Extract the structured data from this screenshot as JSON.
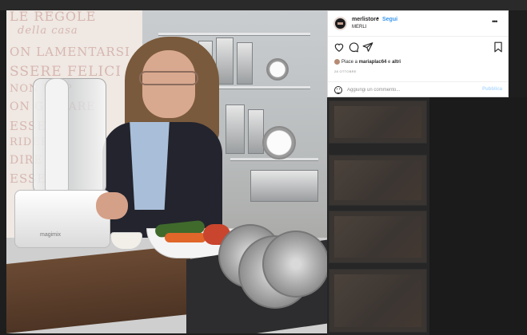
{
  "wall_text": [
    "LE REGOLE",
    "della casa",
    "ON LAMENTARSI",
    "SSERE FELICI",
    "NON DISP",
    "ON GRIDARE",
    "ESSERE",
    "RIDERE",
    "DIRE",
    "ESSERE"
  ],
  "product": {
    "brand": "magimix"
  },
  "post": {
    "username": "merlistore",
    "separator": "•",
    "follow_label": "Segui",
    "location": "MERLI",
    "more_icon": "more-options-icon",
    "likes_prefix": "Piace a ",
    "likes_user": "mariaplac64",
    "likes_middle": " e ",
    "likes_others": "altri",
    "date": "28 OTTOBRE",
    "comment_placeholder": "Aggiungi un commento...",
    "publish_label": "Pubblica",
    "icons": [
      "heart-icon",
      "comment-icon",
      "share-icon",
      "bookmark-icon",
      "emoji-icon"
    ]
  },
  "colors": {
    "link": "#3897f0",
    "publish_disabled": "#b3dbff",
    "text": "#262626",
    "muted": "#8e8e8e"
  }
}
